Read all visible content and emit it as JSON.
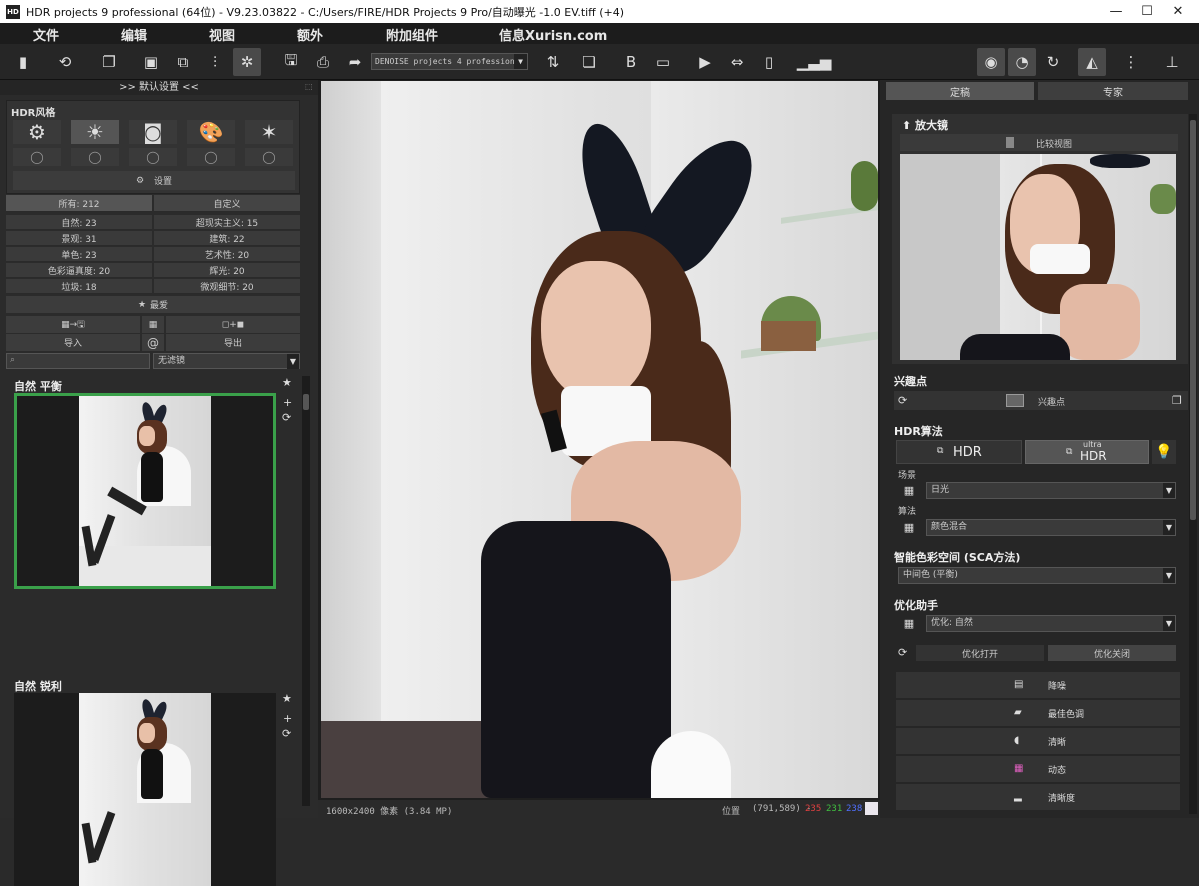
{
  "window": {
    "title": "HDR projects 9 professional (64位) - V9.23.03822 - C:/Users/FIRE/HDR Projects 9 Pro/自动曝光 -1.0 EV.tiff (+4)",
    "app_icon": "HD",
    "minimize": "—",
    "maximize": "☐",
    "close": "✕"
  },
  "menu": [
    "文件",
    "编辑",
    "视图",
    "额外",
    "附加组件",
    "信息Xurisn.com"
  ],
  "toolbar": {
    "denoise_select": "DENOISE projects 4 professional"
  },
  "left_panel": {
    "header": ">> 默认设置 <<",
    "hdr_style_title": "HDR风格",
    "settings_label": "设置",
    "filter_tabs": {
      "all": "所有: 212",
      "custom": "自定义"
    },
    "categories": [
      {
        "left": "自然: 23",
        "right": "超现实主义: 15"
      },
      {
        "left": "景观: 31",
        "right": "建筑: 22"
      },
      {
        "left": "单色: 23",
        "right": "艺术性: 20"
      },
      {
        "left": "色彩逼真度: 20",
        "right": "辉光: 20"
      },
      {
        "left": "垃圾: 18",
        "right": "微观细节: 20"
      }
    ],
    "favorites_label": "最爱",
    "import_label": "导入",
    "export_label": "导出",
    "at_symbol": "@",
    "search_placeholder": "",
    "filter_select": "无滤镜",
    "presets": [
      {
        "name": "自然 平衡"
      },
      {
        "name": "自然 锐利"
      }
    ]
  },
  "center": {
    "dimensions": "1600x2400 像素 (3.84 MP)",
    "position_label": "位置",
    "position_value": "(791,589) -",
    "rgb": {
      "r": "235",
      "g": "231",
      "b": "238"
    }
  },
  "right_panel": {
    "tabs": {
      "left": "定稿",
      "right": "专家"
    },
    "magnifier_title": "放大镜",
    "compare_label": "比较视图",
    "poi_title": "兴趣点",
    "poi_button": "兴趣点",
    "hdr_algo_title": "HDR算法",
    "hdr_btn": "HDR",
    "ultra_small": "ultra",
    "ultra_hdr": "HDR",
    "scene_label": "场景",
    "scene_value": "日光",
    "algo_label": "算法",
    "algo_value": "颜色混合",
    "sca_title": "智能色彩空间 (SCA方法)",
    "sca_value": "中间色 (平衡)",
    "opt_title": "优化助手",
    "opt_value": "优化: 自然",
    "opt_on": "优化打开",
    "opt_off": "优化关闭",
    "options": [
      "降噪",
      "最佳色调",
      "清晰",
      "动态",
      "清晰度"
    ]
  },
  "colors": {
    "accent_green": "#3aa04a",
    "red": "#e04040",
    "green": "#40c040",
    "blue": "#5070ff"
  }
}
